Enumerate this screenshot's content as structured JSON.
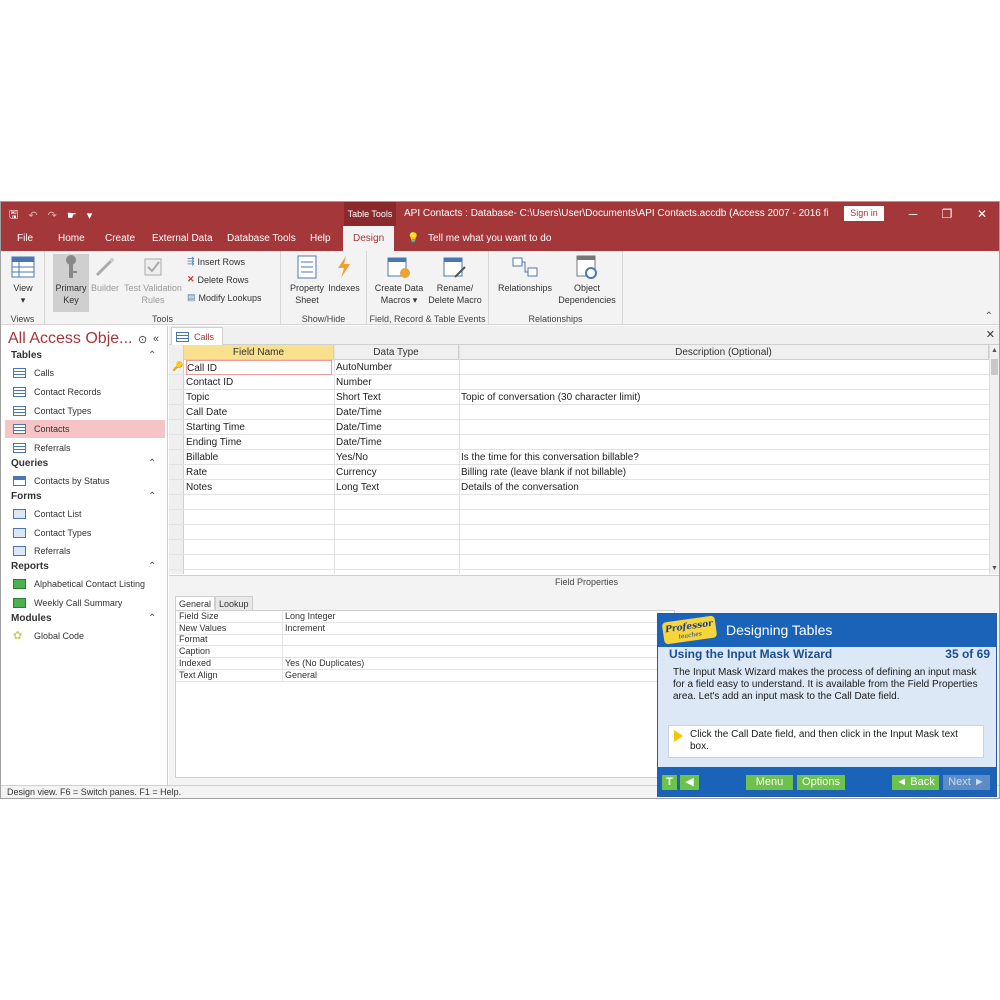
{
  "window": {
    "title": "API Contacts : Database- C:\\Users\\User\\Documents\\API Contacts.accdb (Access 2007 - 2016 file form...",
    "context_tab": "Table Tools",
    "sign_in": "Sign in",
    "controls": {
      "minimize": "─",
      "restore": "❐",
      "close": "✕"
    }
  },
  "qat": {
    "save": "🖫",
    "undo": "↶",
    "redo": "↷",
    "touch": "☛",
    "customize": "▾"
  },
  "menu": {
    "file": "File",
    "home": "Home",
    "create": "Create",
    "external": "External Data",
    "dbtools": "Database Tools",
    "help": "Help",
    "design": "Design",
    "tell_me": "Tell me what you want to do"
  },
  "ribbon": {
    "views": {
      "view": "View",
      "label": "Views"
    },
    "tools": {
      "primary_key": "Primary Key",
      "builder": "Builder",
      "test_validation": "Test Validation Rules",
      "insert_rows": "Insert Rows",
      "delete_rows": "Delete Rows",
      "modify_lookups": "Modify Lookups",
      "label": "Tools"
    },
    "showhide": {
      "property_sheet": "Property Sheet",
      "indexes": "Indexes",
      "label": "Show/Hide"
    },
    "events": {
      "create_macros": "Create Data Macros",
      "rename_macro": "Rename/ Delete Macro",
      "label": "Field, Record & Table Events"
    },
    "relationships": {
      "relationships": "Relationships",
      "object_deps": "Object Dependencies",
      "label": "Relationships"
    }
  },
  "nav": {
    "title": "All Access Obje...",
    "sections": [
      {
        "name": "Tables",
        "items": [
          "Calls",
          "Contact Records",
          "Contact Types",
          "Contacts",
          "Referrals"
        ]
      },
      {
        "name": "Queries",
        "items": [
          "Contacts by Status"
        ]
      },
      {
        "name": "Forms",
        "items": [
          "Contact List",
          "Contact Types",
          "Referrals"
        ]
      },
      {
        "name": "Reports",
        "items": [
          "Alphabetical Contact Listing",
          "Weekly Call Summary"
        ]
      },
      {
        "name": "Modules",
        "items": [
          "Global Code"
        ]
      }
    ]
  },
  "doc_tab": "Calls",
  "grid": {
    "headers": [
      "Field Name",
      "Data Type",
      "Description (Optional)"
    ],
    "rows": [
      [
        "Call ID",
        "AutoNumber",
        ""
      ],
      [
        "Contact ID",
        "Number",
        ""
      ],
      [
        "Topic",
        "Short Text",
        "Topic of conversation (30 character limit)"
      ],
      [
        "Call Date",
        "Date/Time",
        ""
      ],
      [
        "Starting Time",
        "Date/Time",
        ""
      ],
      [
        "Ending Time",
        "Date/Time",
        ""
      ],
      [
        "Billable",
        "Yes/No",
        "Is the time for this conversation billable?"
      ],
      [
        "Rate",
        "Currency",
        "Billing rate (leave blank if not billable)"
      ],
      [
        "Notes",
        "Long Text",
        "Details of the conversation"
      ]
    ]
  },
  "field_properties": {
    "title": "Field Properties",
    "tabs": [
      "General",
      "Lookup"
    ],
    "rows": [
      [
        "Field Size",
        "Long Integer"
      ],
      [
        "New Values",
        "Increment"
      ],
      [
        "Format",
        ""
      ],
      [
        "Caption",
        ""
      ],
      [
        "Indexed",
        "Yes (No Duplicates)"
      ],
      [
        "Text Align",
        "General"
      ]
    ]
  },
  "status": "Design view.  F6 = Switch panes.  F1 = Help.",
  "tutorial": {
    "logo_main": "Professor",
    "logo_sub": "teaches",
    "header": "Designing Tables",
    "subtitle": "Using the Input Mask Wizard",
    "count": "35 of 69",
    "text": "The Input Mask Wizard makes the process of defining an input mask for a field easy to understand. It is available from the Field Properties area. Let's add an input mask to the Call Date field.",
    "instruction": "Click the Call Date field, and then click in the Input Mask text box.",
    "buttons": {
      "t": "T",
      "audio": "◀",
      "menu": "Menu",
      "options": "Options",
      "back": "◄ Back",
      "next": "Next ►"
    }
  },
  "colors": {
    "accent": "#a4373a",
    "tutorial_blue": "#1b63b8",
    "tutorial_green": "#6cc24a"
  }
}
